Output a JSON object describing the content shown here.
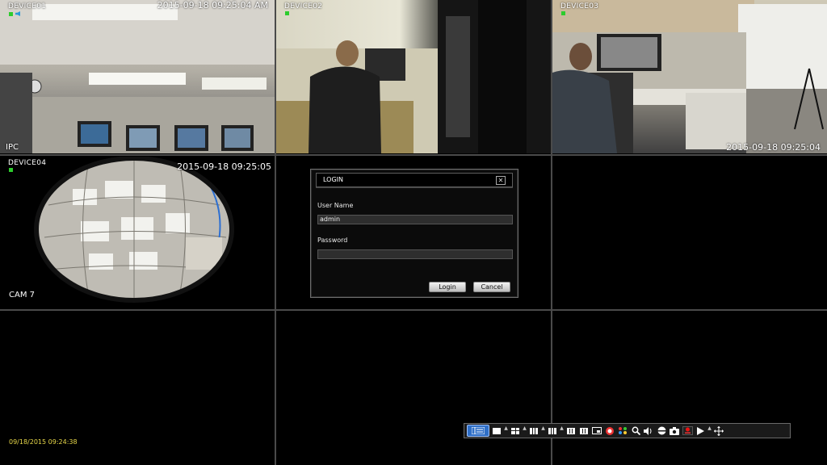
{
  "cameras": [
    {
      "device": "DEVICE01",
      "timestamp": "2015-09-18 09:25:04 AM",
      "corner_label": "IPC"
    },
    {
      "device": "DEVICE02"
    },
    {
      "device": "DEVICE03",
      "timestamp": "2015-09-18 09:25:04"
    },
    {
      "device": "DEVICE04",
      "timestamp": "2015-09-18 09:25:05",
      "corner_label": "CAM 7"
    }
  ],
  "login_dialog": {
    "title": "LOGIN",
    "close_glyph": "✕",
    "username_label": "User Name",
    "username_value": "admin",
    "password_label": "Password",
    "password_value": "",
    "login_button": "Login",
    "cancel_button": "Cancel"
  },
  "system_date_time": "09/18/2015 09:24:38",
  "toolbar": {
    "buttons": [
      "menu-icon",
      "single-view-icon",
      "quad-view-icon",
      "nine-view-icon",
      "custom-view-icon",
      "sixteen-view-icon",
      "grid-view-icon",
      "pip-icon",
      "color-icon",
      "sequence-icon",
      "zoom-icon",
      "volume-icon",
      "ptz-icon",
      "snapshot-icon",
      "record-icon",
      "playback-icon",
      "move-icon"
    ]
  },
  "colors": {
    "status_green": "#2dcc2d",
    "toolbar_selected": "#2f6fc7",
    "date_yellow": "#e8d84a"
  }
}
